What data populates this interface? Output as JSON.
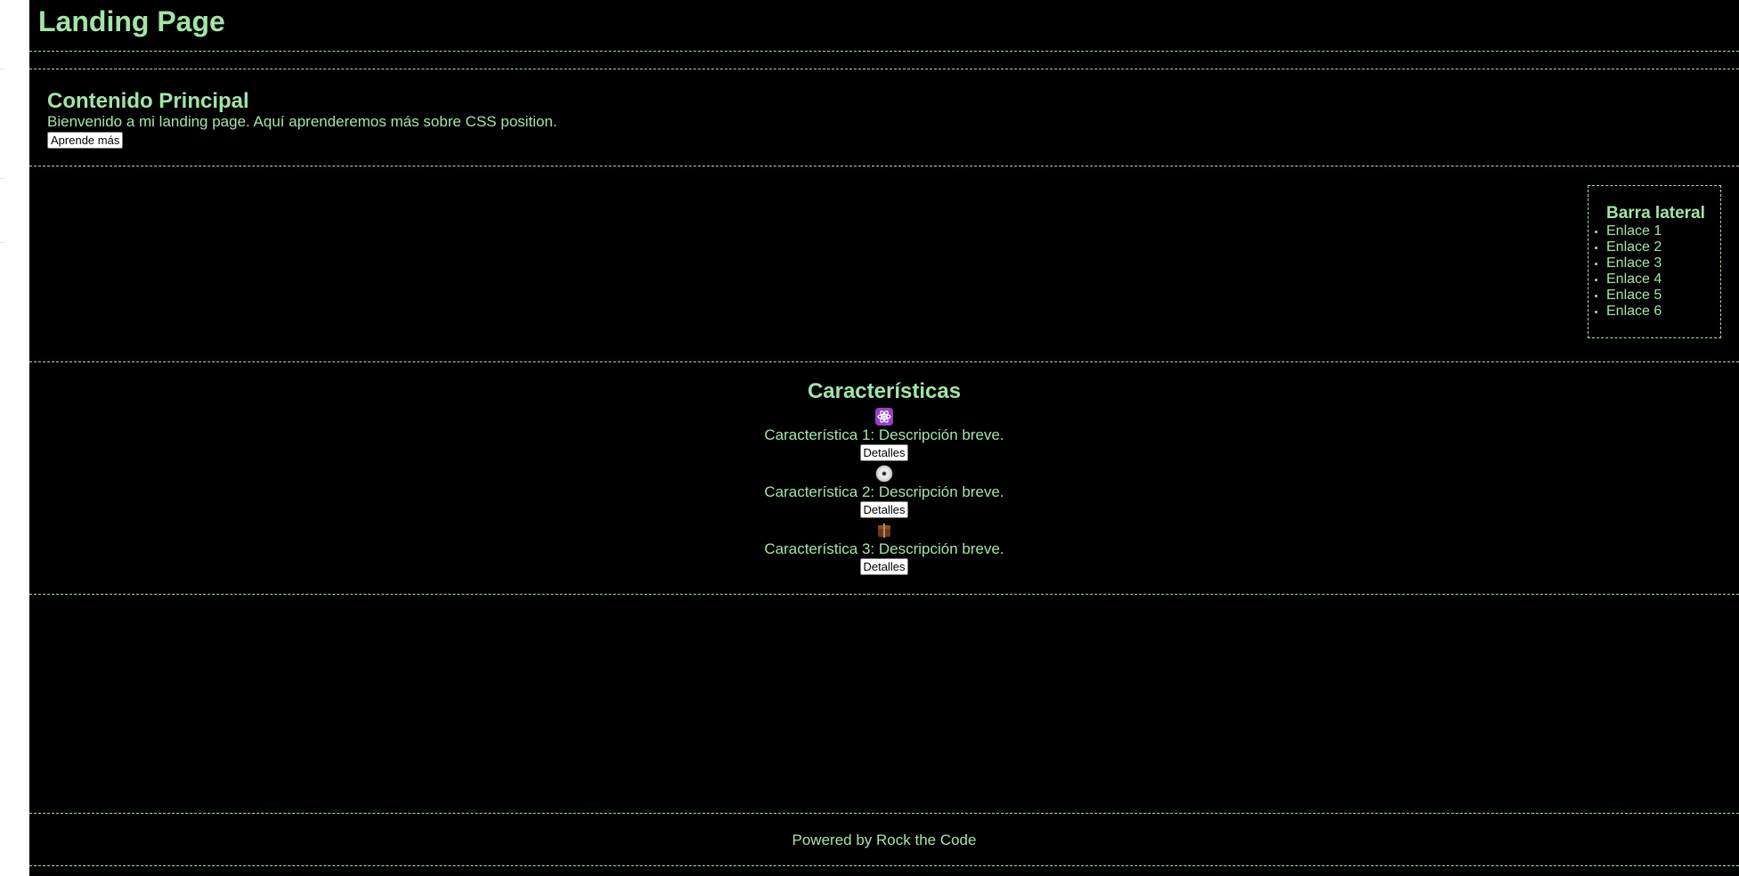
{
  "header": {
    "title": "Landing Page"
  },
  "main": {
    "title": "Contenido Principal",
    "text": "Bienvenido a mi landing page. Aquí aprenderemos más sobre CSS position.",
    "button": "Aprende más"
  },
  "sidebar": {
    "title": "Barra lateral",
    "links": [
      "Enlace 1",
      "Enlace 2",
      "Enlace 3",
      "Enlace 4",
      "Enlace 5",
      "Enlace 6"
    ]
  },
  "features": {
    "title": "Características",
    "items": [
      {
        "icon": "atom-icon",
        "text": "Característica 1: Descripción breve.",
        "button": "Detalles"
      },
      {
        "icon": "disc-icon",
        "text": "Característica 2: Descripción breve.",
        "button": "Detalles"
      },
      {
        "icon": "box-icon",
        "text": "Característica 3: Descripción breve.",
        "button": "Detalles"
      }
    ]
  },
  "footer": {
    "text": "Powered by Rock the Code"
  },
  "colors": {
    "accent": "#a3e4a8",
    "background": "#000000"
  }
}
